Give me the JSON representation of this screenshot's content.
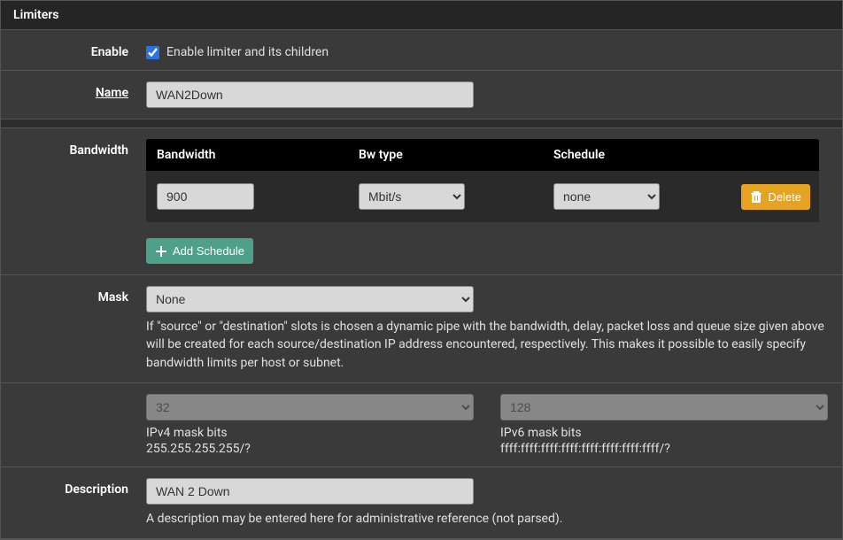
{
  "panel": {
    "title": "Limiters"
  },
  "enable": {
    "label": "Enable",
    "checked": true,
    "text": "Enable limiter and its children"
  },
  "name": {
    "label": "Name",
    "value": "WAN2Down"
  },
  "bandwidth": {
    "label": "Bandwidth",
    "headers": {
      "bw": "Bandwidth",
      "type": "Bw type",
      "sched": "Schedule"
    },
    "row": {
      "value": "900",
      "type": "Mbit/s",
      "schedule": "none"
    },
    "delete_btn": "Delete",
    "add_btn": "Add Schedule"
  },
  "mask": {
    "label": "Mask",
    "value": "None",
    "help": "If \"source\" or \"destination\" slots is chosen a dynamic pipe with the bandwidth, delay, packet loss and queue size given above will be created for each source/destination IP address encountered, respectively. This makes it possible to easily specify bandwidth limits per host or subnet."
  },
  "maskbits": {
    "ipv4": {
      "value": "32",
      "label": "IPv4 mask bits",
      "sub": "255.255.255.255/?"
    },
    "ipv6": {
      "value": "128",
      "label": "IPv6 mask bits",
      "sub": "ffff:ffff:ffff:ffff:ffff:ffff:ffff:ffff/?"
    }
  },
  "description": {
    "label": "Description",
    "value": "WAN 2 Down",
    "help": "A description may be entered here for administrative reference (not parsed)."
  }
}
